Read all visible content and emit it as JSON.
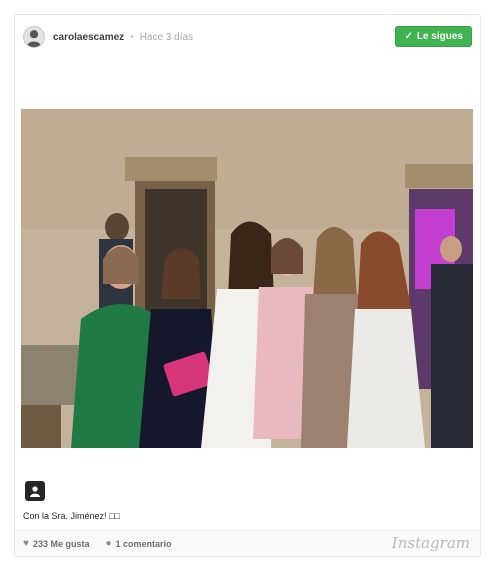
{
  "post": {
    "username": "carolaescamez",
    "separator": "•",
    "time_ago": "Hace 3 días",
    "follow_label": "Le sigues",
    "follow_check": "✓",
    "caption": "Con la Sra. Jiménez! □□",
    "likes_label": "233 Me gusta",
    "comments_label": "1 comentario",
    "brand": "Instagram"
  },
  "icons": {
    "avatar": "avatar-icon",
    "tag": "tagged-people-icon",
    "like": "heart-icon",
    "comment": "comment-bubble-icon"
  },
  "colors": {
    "follow_button": "#3fb34f",
    "text_primary": "#262626",
    "text_muted": "#a8a8a8"
  }
}
